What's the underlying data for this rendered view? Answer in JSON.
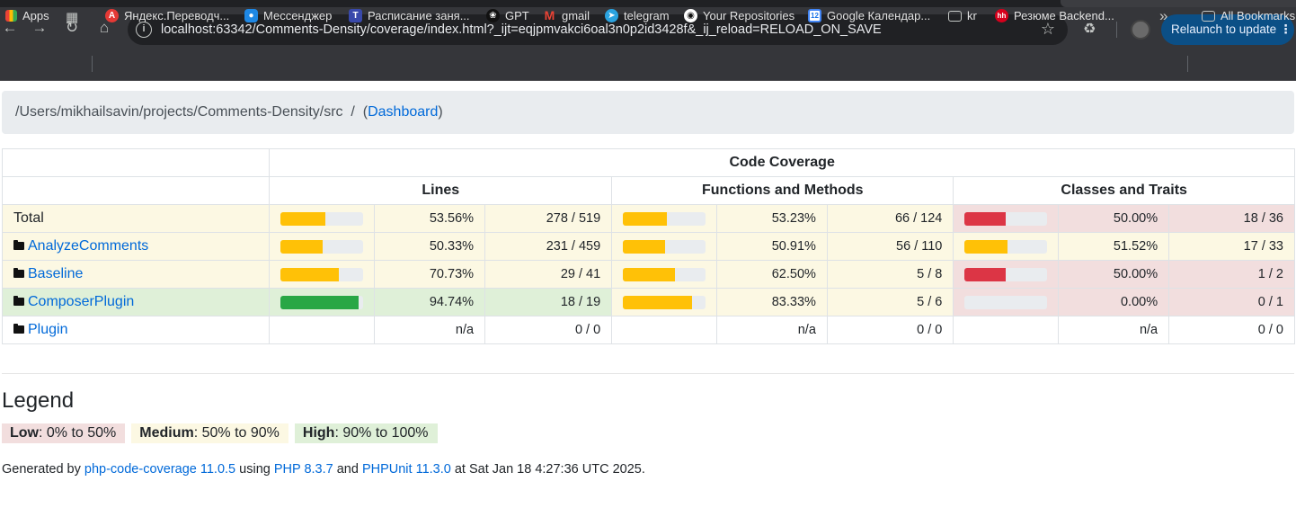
{
  "browser": {
    "url": "localhost:63342/Comments-Density/coverage/index.html?_ijt=eqjpmvakci6oal3n0p2id3428f&_ij_reload=RELOAD_ON_SAVE",
    "relaunch_label": "Relaunch to update",
    "bookmarks": [
      {
        "label": "Apps",
        "icon": "apps-grid-icon"
      },
      {
        "label": "Яндекс.Переводч...",
        "icon": "yandex-translate-icon"
      },
      {
        "label": "Мессенджер",
        "icon": "messenger-icon"
      },
      {
        "label": "Расписание заня...",
        "icon": "schedule-icon"
      },
      {
        "label": "GPT",
        "icon": "openai-icon"
      },
      {
        "label": "gmail",
        "icon": "gmail-icon"
      },
      {
        "label": "telegram",
        "icon": "telegram-icon"
      },
      {
        "label": "Your Repositories",
        "icon": "github-icon"
      },
      {
        "label": "Google Календар...",
        "icon": "google-calendar-icon"
      },
      {
        "label": "kr",
        "icon": "folder-icon"
      },
      {
        "label": "Резюме Backend...",
        "icon": "hh-icon"
      }
    ],
    "more_bookmarks": "»",
    "all_bookmarks": "All Bookmarks"
  },
  "breadcrumb": {
    "path": "/Users/mikhailsavin/projects/Comments-Density/src",
    "separator": "/",
    "open_paren": "(",
    "dashboard_link": "Dashboard",
    "close_paren": ")"
  },
  "table": {
    "group_header": "Code Coverage",
    "columns": [
      "Lines",
      "Functions and Methods",
      "Classes and Traits"
    ],
    "rows": [
      {
        "name": "Total",
        "is_dir": false,
        "lines": {
          "level": "warning",
          "pct": "53.56%",
          "count": "278 / 519",
          "fill": 53.56
        },
        "methods": {
          "level": "warning",
          "pct": "53.23%",
          "count": "66 / 124",
          "fill": 53.23
        },
        "classes": {
          "level": "danger",
          "pct": "50.00%",
          "count": "18 / 36",
          "fill": 50.0
        }
      },
      {
        "name": "AnalyzeComments",
        "is_dir": true,
        "lines": {
          "level": "warning",
          "pct": "50.33%",
          "count": "231 / 459",
          "fill": 50.33
        },
        "methods": {
          "level": "warning",
          "pct": "50.91%",
          "count": "56 / 110",
          "fill": 50.91
        },
        "classes": {
          "level": "warning",
          "pct": "51.52%",
          "count": "17 / 33",
          "fill": 51.52
        }
      },
      {
        "name": "Baseline",
        "is_dir": true,
        "lines": {
          "level": "warning",
          "pct": "70.73%",
          "count": "29 / 41",
          "fill": 70.73
        },
        "methods": {
          "level": "warning",
          "pct": "62.50%",
          "count": "5 / 8",
          "fill": 62.5
        },
        "classes": {
          "level": "danger",
          "pct": "50.00%",
          "count": "1 / 2",
          "fill": 50.0
        }
      },
      {
        "name": "ComposerPlugin",
        "is_dir": true,
        "lines": {
          "level": "success",
          "pct": "94.74%",
          "count": "18 / 19",
          "fill": 94.74
        },
        "methods": {
          "level": "warning",
          "pct": "83.33%",
          "count": "5 / 6",
          "fill": 83.33
        },
        "classes": {
          "level": "danger",
          "pct": "0.00%",
          "count": "0 / 1",
          "fill": 0.0
        }
      },
      {
        "name": "Plugin",
        "is_dir": true,
        "lines": {
          "level": "none",
          "pct": "n/a",
          "count": "0 / 0",
          "fill": null
        },
        "methods": {
          "level": "none",
          "pct": "n/a",
          "count": "0 / 0",
          "fill": null
        },
        "classes": {
          "level": "none",
          "pct": "n/a",
          "count": "0 / 0",
          "fill": null
        }
      }
    ]
  },
  "legend": {
    "title": "Legend",
    "low_label": "Low",
    "low_range": ": 0% to 50%",
    "medium_label": "Medium",
    "medium_range": ": 50% to 90%",
    "high_label": "High",
    "high_range": ": 90% to 100%"
  },
  "footer": {
    "prefix": "Generated by ",
    "tool": "php-code-coverage 11.0.5",
    "using": " using ",
    "php": "PHP 8.3.7",
    "and": " and ",
    "phpunit": "PHPUnit 11.3.0",
    "suffix": " at Sat Jan 18 4:27:36 UTC 2025."
  },
  "colors": {
    "warning_bg": "#fcf8e3",
    "danger_bg": "#f2dede",
    "success_bg": "#dff0d8",
    "warning_bar": "#ffc107",
    "danger_bar": "#dc3545",
    "success_bar": "#28a745",
    "link": "#0069d9"
  }
}
